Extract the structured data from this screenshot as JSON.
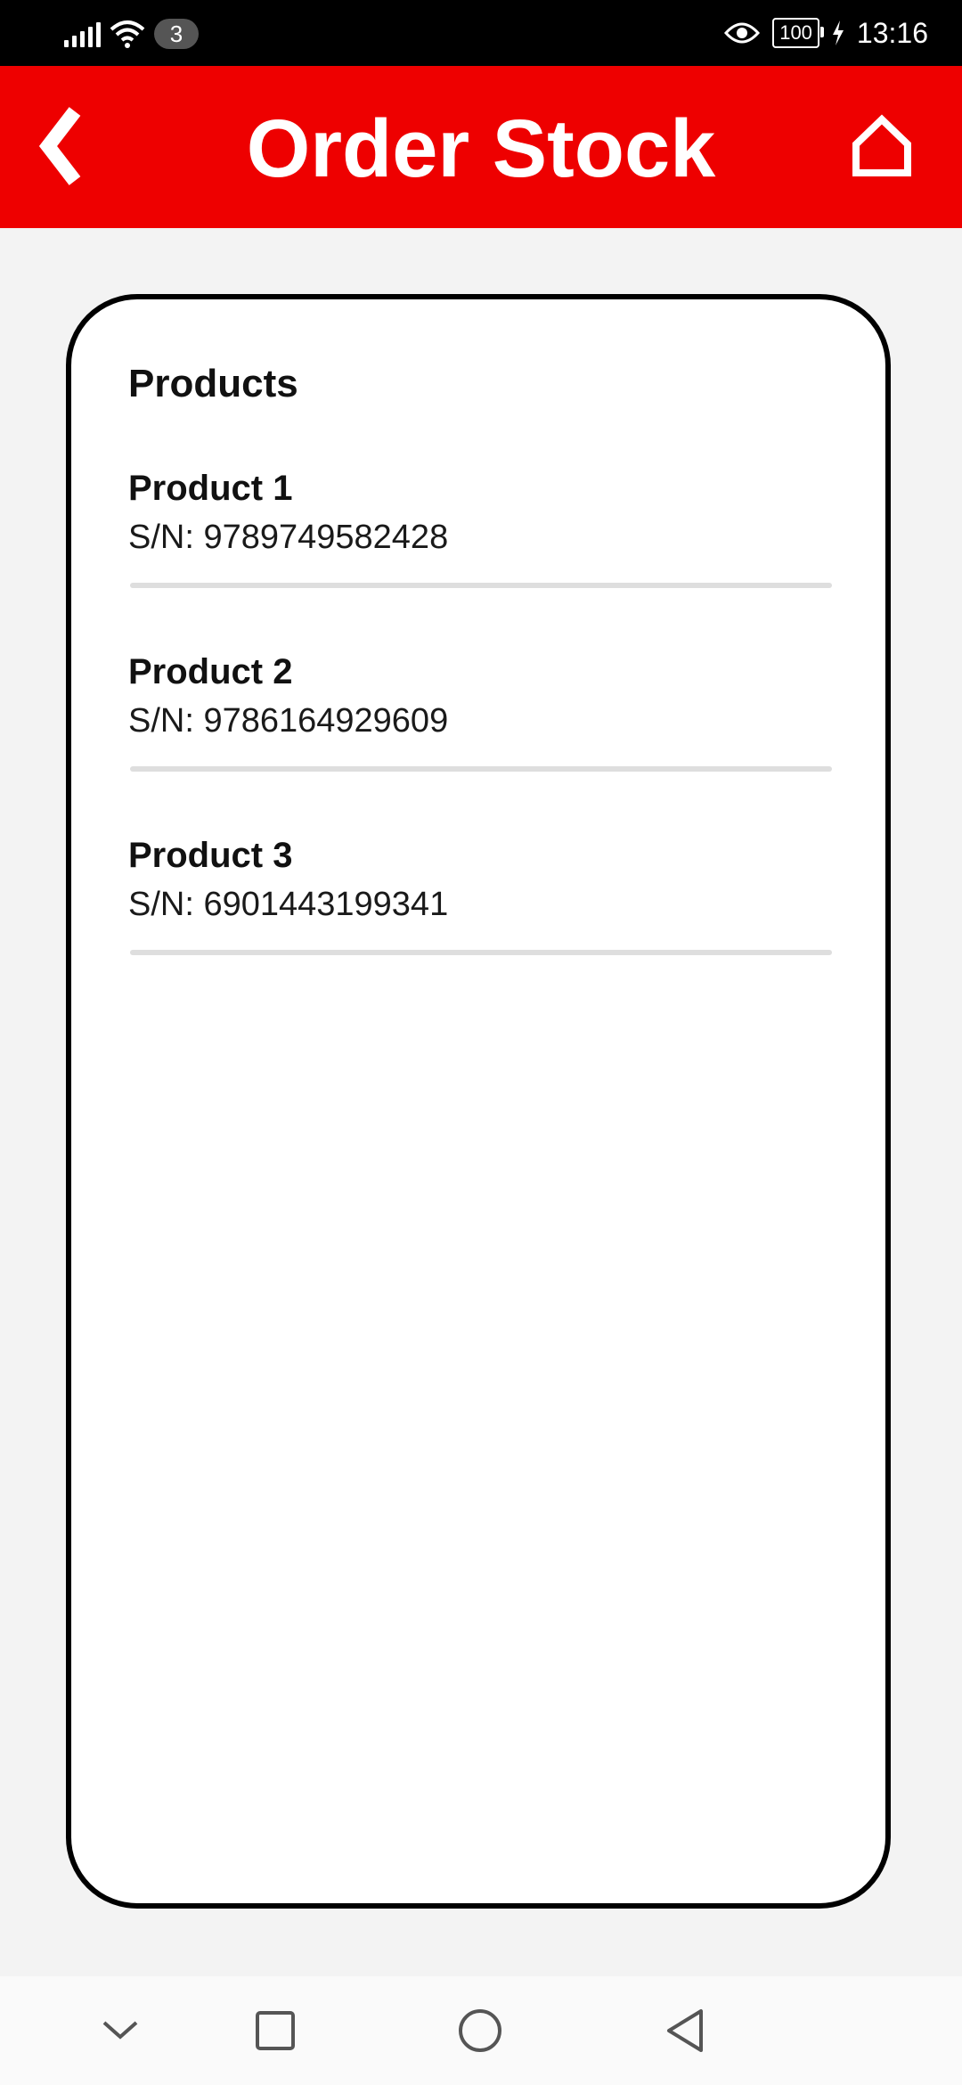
{
  "status_bar": {
    "notification_count": "3",
    "battery": "100",
    "time": "13:16"
  },
  "app_bar": {
    "title": "Order Stock"
  },
  "card": {
    "section_title": "Products",
    "products": [
      {
        "name": "Product 1",
        "serial": "S/N: 9789749582428"
      },
      {
        "name": "Product 2",
        "serial": "S/N: 9786164929609"
      },
      {
        "name": "Product 3",
        "serial": "S/N: 6901443199341"
      }
    ]
  },
  "colors": {
    "accent": "#ee0000",
    "card_border": "#000000",
    "background": "#f3f3f3"
  },
  "icons": {
    "back": "chevron-left-icon",
    "home": "home-icon",
    "nav_down": "chevron-down-icon",
    "nav_recent": "square-icon",
    "nav_home": "circle-icon",
    "nav_back": "triangle-back-icon"
  }
}
